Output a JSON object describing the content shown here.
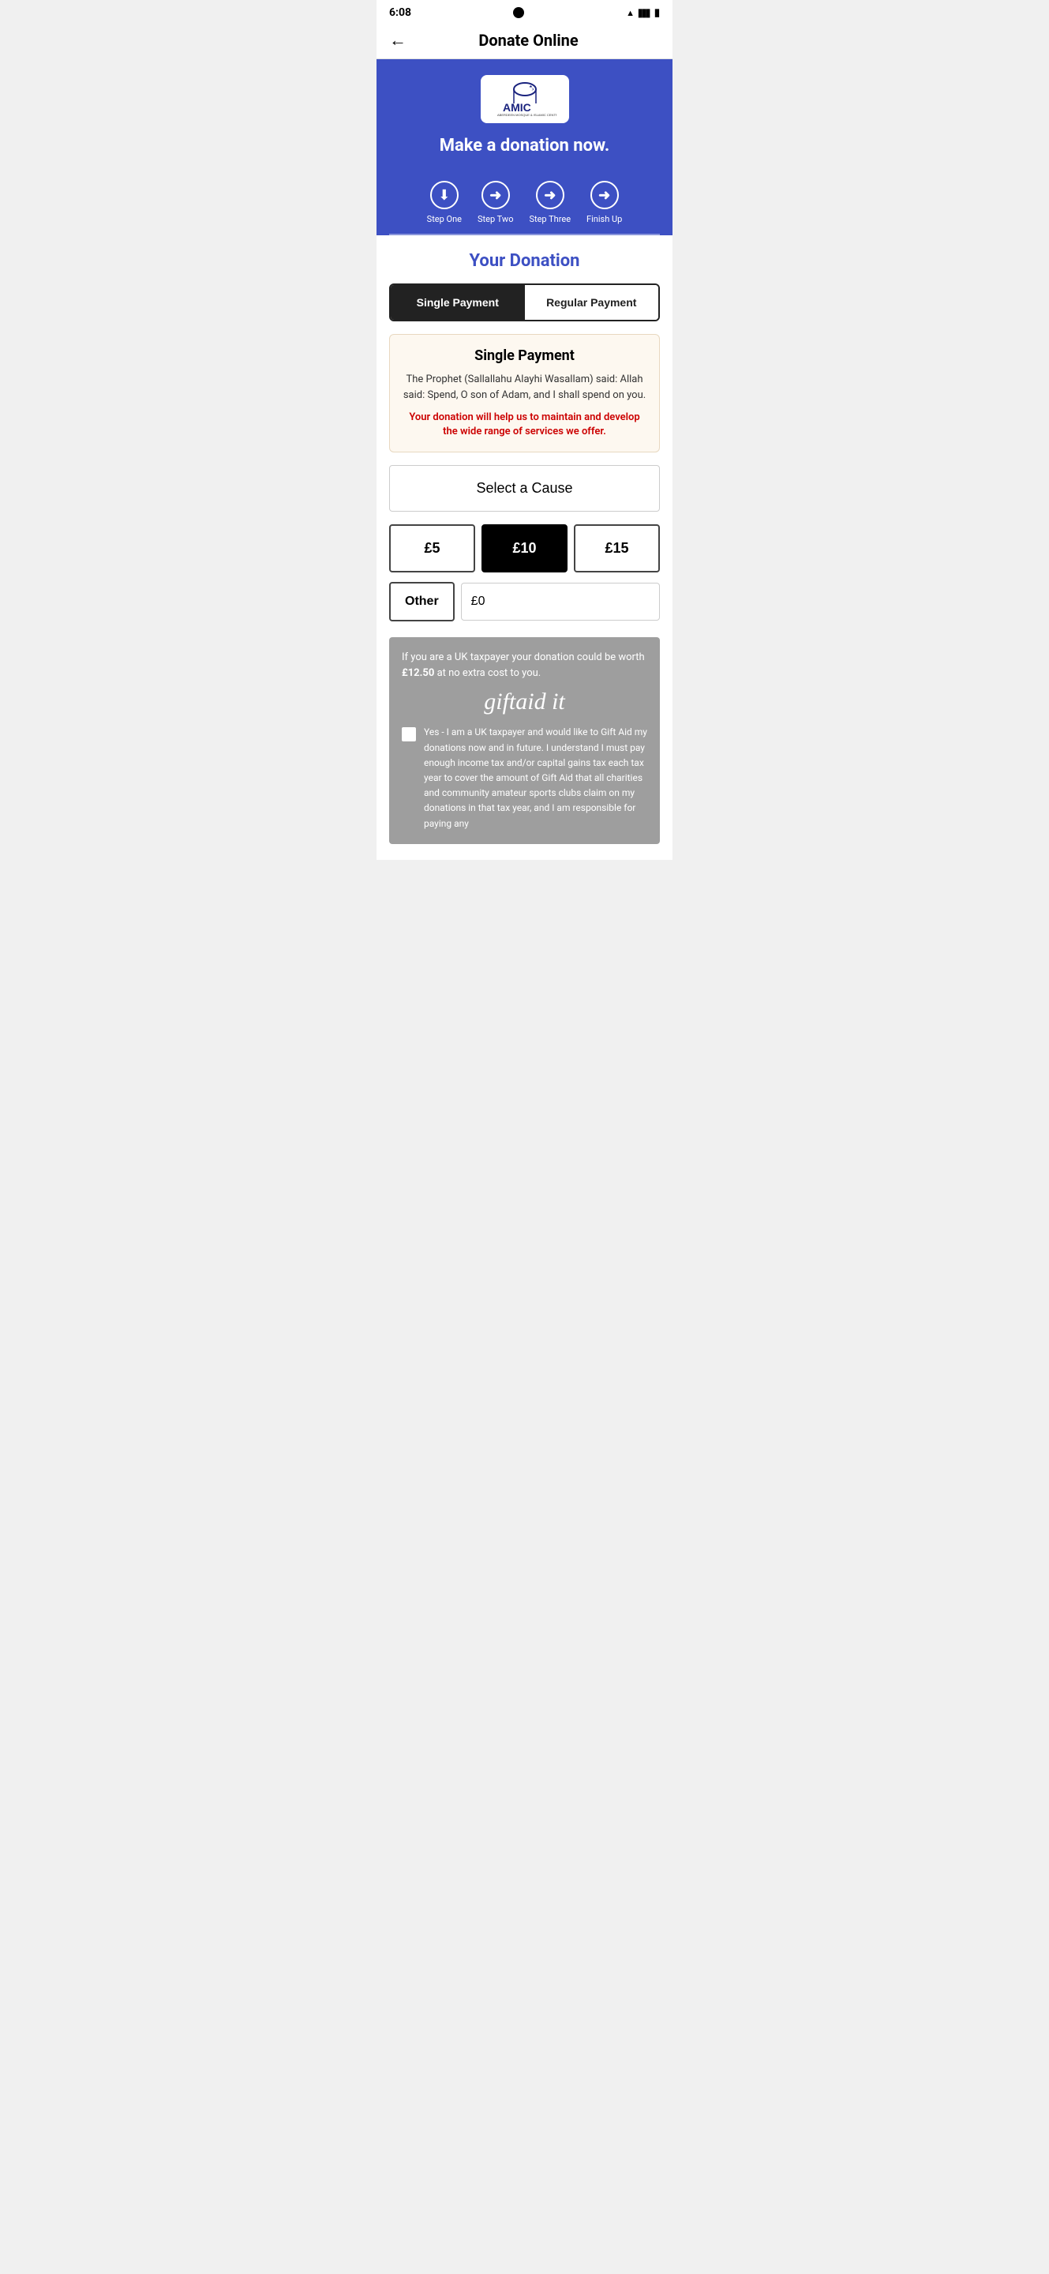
{
  "statusBar": {
    "time": "6:08",
    "icons": [
      "wifi",
      "signal",
      "battery"
    ]
  },
  "navBar": {
    "backLabel": "←",
    "title": "Donate Online"
  },
  "logo": {
    "text": "AMIC",
    "subtitle": "ABERDEEN MOSQUE & ISLAMIC CENTRE"
  },
  "headline": "Make a donation now.",
  "steps": [
    {
      "label": "Step One",
      "icon": "↓",
      "type": "download"
    },
    {
      "label": "Step Two",
      "icon": "→",
      "type": "arrow"
    },
    {
      "label": "Step Three",
      "icon": "→",
      "type": "arrow"
    },
    {
      "label": "Finish Up",
      "icon": "→",
      "type": "arrow"
    }
  ],
  "donationSection": {
    "title": "Your Donation",
    "paymentToggle": {
      "singleLabel": "Single Payment",
      "regularLabel": "Regular Payment",
      "activeTab": "single"
    },
    "singlePayment": {
      "title": "Single Payment",
      "quote": "The Prophet (Sallallahu Alayhi Wasallam) said: Allah said: Spend, O son of Adam, and I shall spend on you.",
      "message": "Your donation will help us to maintain and develop the wide range of services we offer."
    },
    "selectCauseLabel": "Select a Cause",
    "amounts": [
      {
        "label": "£5",
        "selected": false
      },
      {
        "label": "£10",
        "selected": true
      },
      {
        "label": "£15",
        "selected": false
      }
    ],
    "otherLabel": "Other",
    "otherInputValue": "£0",
    "otherInputPlaceholder": "£0"
  },
  "giftAid": {
    "introText": "If you are a UK taxpayer your donation could be worth ",
    "boldAmount": "£12.50",
    "introSuffix": " at no extra cost to you.",
    "logoText": "giftaid it",
    "checkboxChecked": false,
    "agreementText": "Yes - I am a UK taxpayer and would like to Gift Aid my donations now and in future. I understand I must pay enough income tax and/or capital gains tax each tax year to cover the amount of Gift Aid that all charities and community amateur sports clubs claim on my donations in that tax year, and I am responsible for paying any"
  }
}
